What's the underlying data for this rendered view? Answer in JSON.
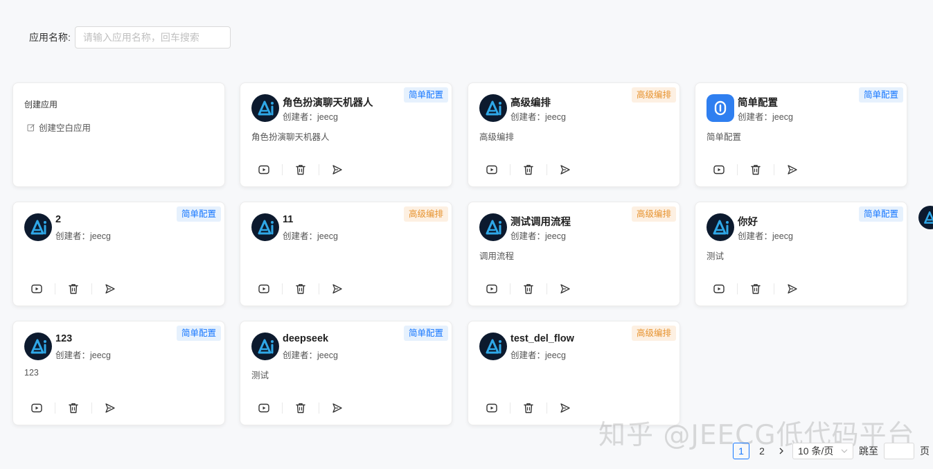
{
  "search": {
    "label": "应用名称",
    "colon": ":",
    "placeholder": "请输入应用名称，回车搜索",
    "value": ""
  },
  "create_card": {
    "title": "创建应用",
    "blank_label": "创建空白应用"
  },
  "creator_prefix": "创建者：",
  "apps": [
    {
      "name": "角色扮演聊天机器人",
      "creator": "jeecg",
      "description": "角色扮演聊天机器人",
      "tag": "简单配置",
      "tag_type": "simple",
      "avatar": "ai-logo-icon"
    },
    {
      "name": "高级编排",
      "creator": "jeecg",
      "description": "高级编排",
      "tag": "高级编排",
      "tag_type": "advanced",
      "avatar": "ai-logo-icon"
    },
    {
      "name": "简单配置",
      "creator": "jeecg",
      "description": "简单配置",
      "tag": "简单配置",
      "tag_type": "simple",
      "avatar": "app-square-icon"
    },
    {
      "name": "2",
      "creator": "jeecg",
      "description": "",
      "tag": "简单配置",
      "tag_type": "simple",
      "avatar": "ai-logo-icon"
    },
    {
      "name": "11",
      "creator": "jeecg",
      "description": "",
      "tag": "高级编排",
      "tag_type": "advanced",
      "avatar": "ai-logo-icon"
    },
    {
      "name": "测试调用流程",
      "creator": "jeecg",
      "description": "调用流程",
      "tag": "高级编排",
      "tag_type": "advanced",
      "avatar": "ai-logo-icon"
    },
    {
      "name": "你好",
      "creator": "jeecg",
      "description": "测试",
      "tag": "简单配置",
      "tag_type": "simple",
      "avatar": "ai-logo-icon"
    },
    {
      "name": "123",
      "creator": "jeecg",
      "description": "123",
      "tag": "简单配置",
      "tag_type": "simple",
      "avatar": "ai-logo-icon"
    },
    {
      "name": "deepseek",
      "creator": "jeecg",
      "description": "测试",
      "tag": "简单配置",
      "tag_type": "simple",
      "avatar": "ai-logo-icon"
    },
    {
      "name": "test_del_flow",
      "creator": "jeecg",
      "description": "",
      "tag": "高级编排",
      "tag_type": "advanced",
      "avatar": "ai-logo-icon"
    }
  ],
  "card_actions": [
    "play-icon",
    "delete-icon",
    "send-icon"
  ],
  "watermark": "知乎 @JEECG低代码平台",
  "pagination": {
    "pages": [
      "1",
      "2"
    ],
    "current": "1",
    "page_size": "10 条/页",
    "jump_label": "跳至",
    "page_unit": "页"
  },
  "colors": {
    "primary": "#1677ff",
    "simple_tag_bg": "#e6f1fd",
    "advanced_tag": "#e6922e",
    "advanced_tag_bg": "#fdf0e2",
    "avatar_dark": "#0c1a2e",
    "ai_logo": "#2fa8e8"
  }
}
